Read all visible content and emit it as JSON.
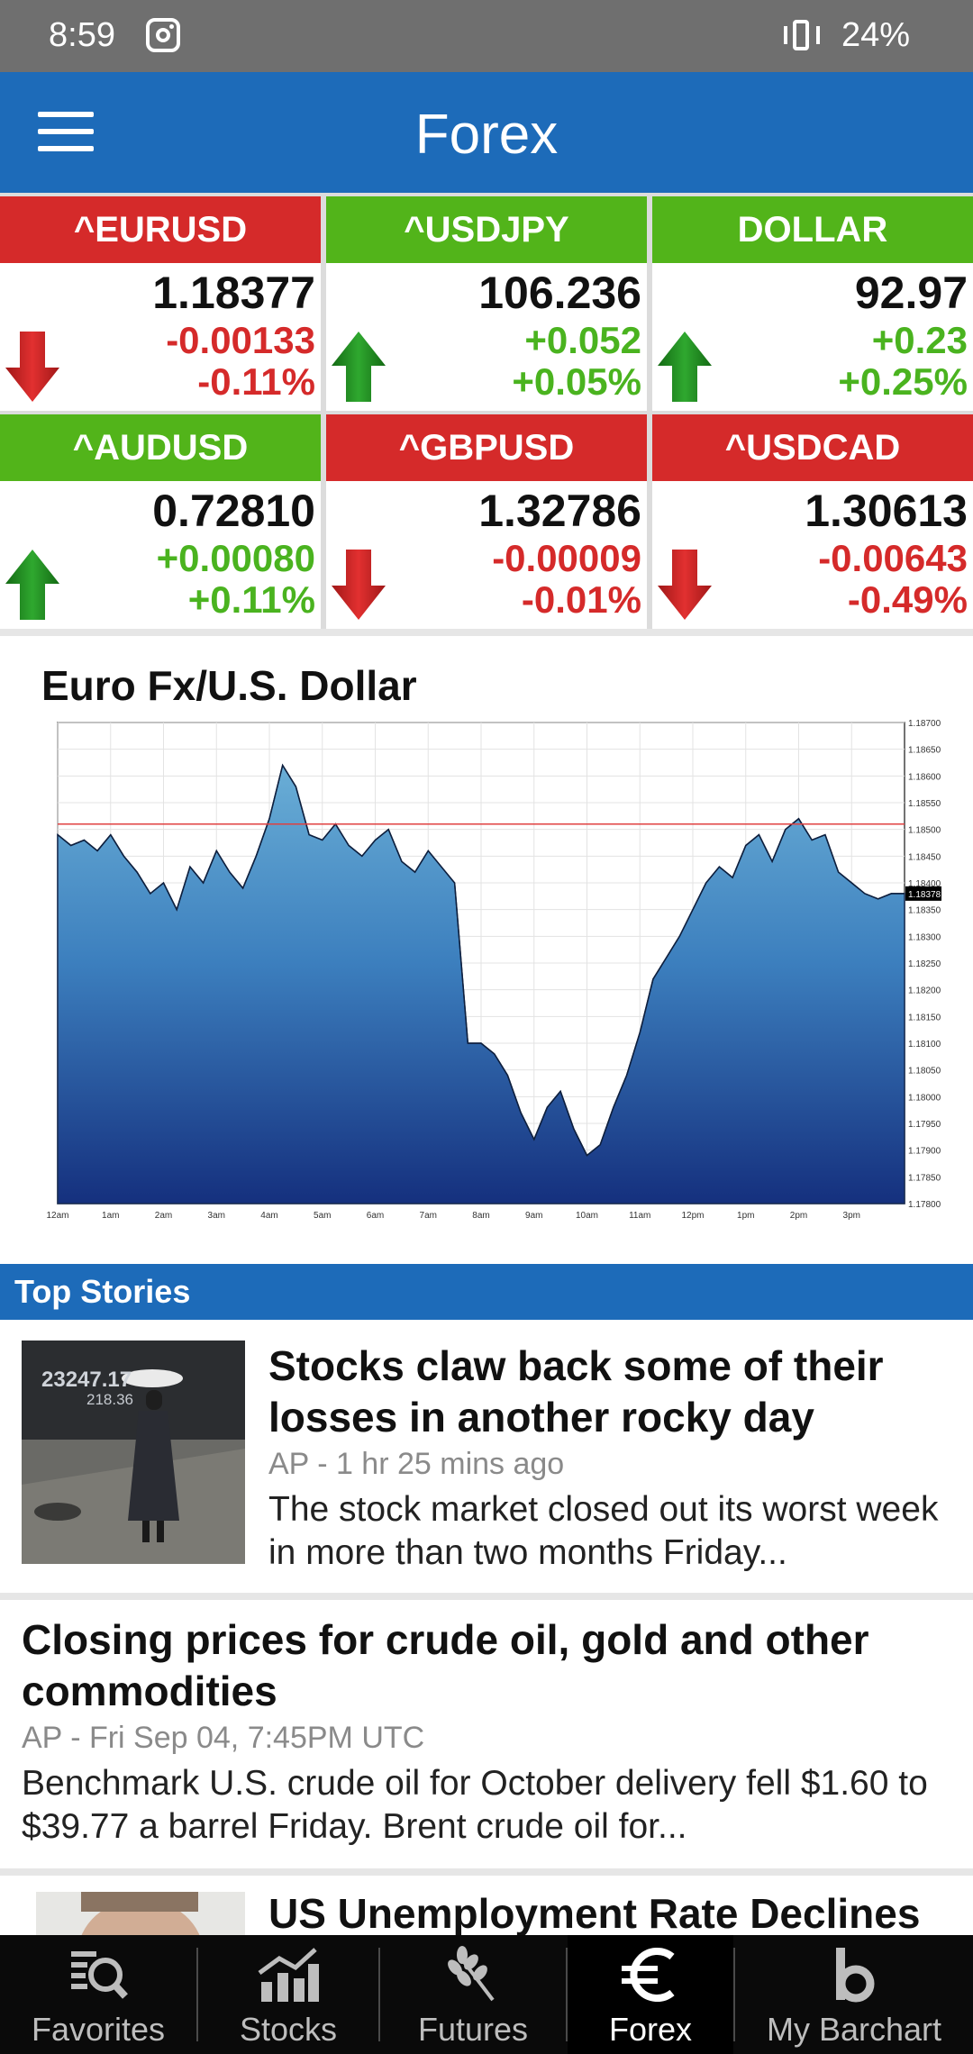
{
  "status_bar": {
    "time": "8:59",
    "battery": "24%",
    "icons": [
      "instagram-icon",
      "vibrate-icon"
    ]
  },
  "app_bar": {
    "title": "Forex",
    "menu_icon": "hamburger-menu-icon"
  },
  "quotes": [
    {
      "symbol": "^EURUSD",
      "price": "1.18377",
      "change": "-0.00133",
      "percent": "-0.11%",
      "direction": "down"
    },
    {
      "symbol": "^USDJPY",
      "price": "106.236",
      "change": "+0.052",
      "percent": "+0.05%",
      "direction": "up"
    },
    {
      "symbol": "DOLLAR",
      "price": "92.97",
      "change": "+0.23",
      "percent": "+0.25%",
      "direction": "up"
    },
    {
      "symbol": "^AUDUSD",
      "price": "0.72810",
      "change": "+0.00080",
      "percent": "+0.11%",
      "direction": "up"
    },
    {
      "symbol": "^GBPUSD",
      "price": "1.32786",
      "change": "-0.00009",
      "percent": "-0.01%",
      "direction": "down"
    },
    {
      "symbol": "^USDCAD",
      "price": "1.30613",
      "change": "-0.00643",
      "percent": "-0.49%",
      "direction": "down"
    }
  ],
  "colors": {
    "brand_blue": "#1d6bb9",
    "down_red": "#d52a2a",
    "up_green": "#52b41a",
    "nav_bg": "#0a0a0a"
  },
  "chart": {
    "title": "Euro Fx/U.S. Dollar"
  },
  "chart_data": {
    "type": "area",
    "title": "Euro Fx/U.S. Dollar",
    "x_ticks": [
      "12am",
      "1am",
      "2am",
      "3am",
      "4am",
      "5am",
      "6am",
      "7am",
      "8am",
      "9am",
      "10am",
      "11am",
      "12pm",
      "1pm",
      "2pm",
      "3pm"
    ],
    "y_ticks": [
      "1.18700",
      "1.18650",
      "1.18600",
      "1.18550",
      "1.18500",
      "1.18450",
      "1.18400",
      "1.18350",
      "1.18300",
      "1.18250",
      "1.18200",
      "1.18150",
      "1.18100",
      "1.18050",
      "1.18000",
      "1.17950",
      "1.17900",
      "1.17850",
      "1.17800"
    ],
    "ylim": [
      1.178,
      1.187
    ],
    "xlim": [
      0,
      16
    ],
    "reference_line": 1.1851,
    "last_value_label": "1.18378",
    "x": [
      0.0,
      0.25,
      0.5,
      0.75,
      1.0,
      1.25,
      1.5,
      1.75,
      2.0,
      2.25,
      2.5,
      2.75,
      3.0,
      3.25,
      3.5,
      3.75,
      4.0,
      4.25,
      4.5,
      4.75,
      5.0,
      5.25,
      5.5,
      5.75,
      6.0,
      6.25,
      6.5,
      6.75,
      7.0,
      7.25,
      7.5,
      7.75,
      8.0,
      8.25,
      8.5,
      8.75,
      9.0,
      9.25,
      9.5,
      9.75,
      10.0,
      10.25,
      10.5,
      10.75,
      11.0,
      11.25,
      11.5,
      11.75,
      12.0,
      12.25,
      12.5,
      12.75,
      13.0,
      13.25,
      13.5,
      13.75,
      14.0,
      14.25,
      14.5,
      14.75,
      15.0,
      15.25,
      15.5,
      15.75,
      16.0
    ],
    "values": [
      1.1849,
      1.1847,
      1.1848,
      1.1846,
      1.1849,
      1.1845,
      1.1842,
      1.1838,
      1.184,
      1.1835,
      1.1843,
      1.184,
      1.1846,
      1.1842,
      1.1839,
      1.1845,
      1.1852,
      1.1862,
      1.1858,
      1.1849,
      1.1848,
      1.1851,
      1.1847,
      1.1845,
      1.1848,
      1.185,
      1.1844,
      1.1842,
      1.1846,
      1.1843,
      1.184,
      1.181,
      1.181,
      1.1808,
      1.1804,
      1.1797,
      1.1792,
      1.1798,
      1.1801,
      1.1794,
      1.1789,
      1.1791,
      1.1798,
      1.1804,
      1.1812,
      1.1822,
      1.1826,
      1.183,
      1.1835,
      1.184,
      1.1843,
      1.1841,
      1.1847,
      1.1849,
      1.1844,
      1.185,
      1.1852,
      1.1848,
      1.1849,
      1.1842,
      1.184,
      1.1838,
      1.1837,
      1.1838,
      1.1838
    ]
  },
  "top_stories": {
    "header": "Top Stories",
    "items": [
      {
        "headline": "Stocks claw back some of their losses in another rocky day",
        "meta": "AP - 1 hr 25 mins ago",
        "summary": "The stock market closed out its worst week in more than two months Friday...",
        "thumbnail_text": "23247.17",
        "thumbnail_subtext": "218.36"
      },
      {
        "headline": "Closing prices for crude oil, gold and other commodities",
        "meta": "AP - Fri Sep 04, 7:45PM UTC",
        "summary": "Benchmark U.S. crude oil for October delivery fell $1.60 to $39.77 a barrel Friday. Brent crude oil for..."
      },
      {
        "headline": "US Unemployment Rate Declines"
      }
    ]
  },
  "bottom_nav": [
    {
      "label": "Favorites",
      "icon": "favorites-search-icon",
      "active": false
    },
    {
      "label": "Stocks",
      "icon": "stocks-chart-icon",
      "active": false
    },
    {
      "label": "Futures",
      "icon": "wheat-icon",
      "active": false
    },
    {
      "label": "Forex",
      "icon": "euro-icon",
      "active": true
    },
    {
      "label": "My Barchart",
      "icon": "barchart-logo-icon",
      "active": false
    }
  ]
}
